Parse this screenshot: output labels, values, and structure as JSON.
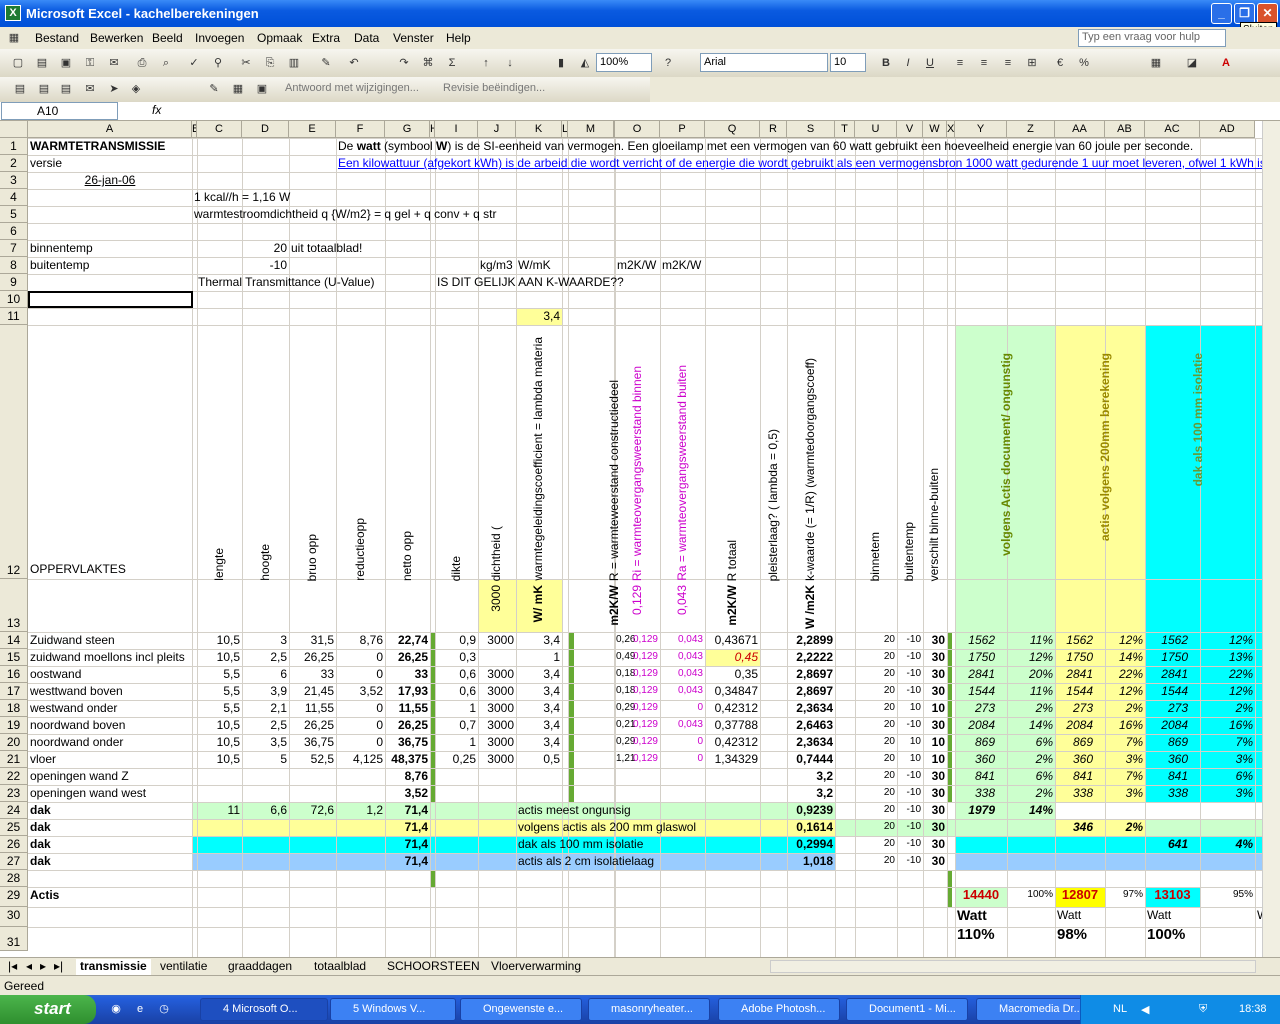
{
  "window": {
    "title": "Microsoft Excel - kachelberekeningen",
    "tooltip": "Sluiten"
  },
  "menu": [
    "Bestand",
    "Bewerken",
    "Beeld",
    "Invoegen",
    "Opmaak",
    "Extra",
    "Data",
    "Venster",
    "Help"
  ],
  "help_placeholder": "Typ een vraag voor hulp",
  "toolbar": {
    "zoom": "100%",
    "font": "Arial",
    "size": "10",
    "reply": "Antwoord met wijzigingen...",
    "revision": "Revisie beëindigen..."
  },
  "formula": {
    "namebox": "A10",
    "fx": "fx"
  },
  "columns": [
    "A",
    "B",
    "C",
    "D",
    "E",
    "F",
    "G",
    "H",
    "I",
    "J",
    "K",
    "L",
    "M",
    "N",
    "O",
    "P",
    "Q",
    "R",
    "S",
    "T",
    "U",
    "V",
    "W",
    "X",
    "Y",
    "Z",
    "AA",
    "AB",
    "AC",
    "AD"
  ],
  "rows": [
    "1",
    "2",
    "3",
    "4",
    "5",
    "6",
    "7",
    "8",
    "9",
    "10",
    "11",
    "12",
    "13",
    "14",
    "15",
    "16",
    "17",
    "18",
    "19",
    "20",
    "21",
    "22",
    "23",
    "24",
    "25",
    "26",
    "27",
    "28",
    "29",
    "30",
    "31"
  ],
  "top": {
    "a1": "WARMTETRANSMISSIE",
    "a2": "versie",
    "a3": "26-jan-06",
    "l1a": "De ",
    "l1b": "watt",
    "l1c": " (symbool ",
    "l1d": "W",
    "l1e": ") is de SI-eenheid van vermogen. Een gloeilamp met een vermogen van 60 watt gebruikt een hoeveelheid energie van 60 joule per seconde.",
    "l2": "Een kilowattuur (afgekort kWh) is de arbeid die wordt verricht of de energie die wordt gebruikt als een vermogensbron 1000 watt gedurende 1 uur moet leveren, ofwel 1 kWh is 3,6",
    "r4": "1 kcal//h = 1,16 W",
    "r5": "warmtestroomdichtheid q {W/m2} = q gel + q conv + q str",
    "a7": "binnentemp",
    "d7": "20",
    "e7": "uit totaalblad!",
    "a8": "buitentemp",
    "d8": "-10",
    "j8": "kg/m3",
    "k8": "W/mK",
    "o8": "m2K/W",
    "p8": "m2K/W",
    "b9": "Thermal Transmittance (U-Value)",
    "i9": "IS DIT GELIJK AAN K-WAARDE??",
    "k11": "3,4",
    "a12": "OPPERVLAKTES"
  },
  "vheaders": {
    "c": "lengte",
    "d": "hoogte",
    "e": "bruo opp",
    "f": "reductieopp",
    "g": "netto opp",
    "i": "dikte",
    "j": "dichtheid (",
    "k": "warmtegeleidingscoefficient = lambda materia",
    "m": "R = warmteweerstand constructiedeel",
    "o": "Ri = warmteovergangsweerstand binnen",
    "p": "Ra = warmteovergangsweerstand buiten",
    "q": "R totaal",
    "r": "pleisterlaag? ( lambda = 0,5)",
    "s": "k-waarde (= 1/R) (warmtedoorgangscoeff)",
    "u": "binnetem",
    "v": "buitentemp",
    "w": "verschilt binne-buiten",
    "y": "volgens Actis document/ ongunstig",
    "aa": "actis volgens 200mm berekening",
    "ac": "dak als 100 mm isolatie"
  },
  "r13": {
    "j": "3000",
    "k": "W/ mK",
    "m": "m2K/W",
    "o": "0,129",
    "p": "0,043",
    "q": "m2K/W",
    "s": "W /m2K"
  },
  "table": [
    [
      "Zuidwand steen",
      "10,5",
      "3",
      "31,5",
      "8,76",
      "22,74",
      "0,9",
      "3000",
      "3,4",
      "0,26",
      "0,129",
      "0,043",
      "0,43671",
      "2,2899",
      "20",
      "-10",
      "30",
      "1562",
      "11%",
      "1562",
      "12%",
      "1562",
      "12%"
    ],
    [
      "zuidwand moellons incl pleits",
      "10,5",
      "2,5",
      "26,25",
      "0",
      "26,25",
      "0,3",
      "",
      "1",
      "0,49",
      "0,129",
      "0,043",
      "0,45",
      "2,2222",
      "20",
      "-10",
      "30",
      "1750",
      "12%",
      "1750",
      "14%",
      "1750",
      "13%"
    ],
    [
      "oostwand",
      "5,5",
      "6",
      "33",
      "0",
      "33",
      "0,6",
      "3000",
      "3,4",
      "0,18",
      "0,129",
      "0,043",
      "0,35",
      "2,8697",
      "20",
      "-10",
      "30",
      "2841",
      "20%",
      "2841",
      "22%",
      "2841",
      "22%"
    ],
    [
      "westtwand boven",
      "5,5",
      "3,9",
      "21,45",
      "3,52",
      "17,93",
      "0,6",
      "3000",
      "3,4",
      "0,18",
      "0,129",
      "0,043",
      "0,34847",
      "2,8697",
      "20",
      "-10",
      "30",
      "1544",
      "11%",
      "1544",
      "12%",
      "1544",
      "12%"
    ],
    [
      "westwand onder",
      "5,5",
      "2,1",
      "11,55",
      "0",
      "11,55",
      "1",
      "3000",
      "3,4",
      "0,29",
      "0,129",
      "0",
      "0,42312",
      "2,3634",
      "20",
      "10",
      "10",
      "273",
      "2%",
      "273",
      "2%",
      "273",
      "2%"
    ],
    [
      "noordwand boven",
      "10,5",
      "2,5",
      "26,25",
      "0",
      "26,25",
      "0,7",
      "3000",
      "3,4",
      "0,21",
      "0,129",
      "0,043",
      "0,37788",
      "2,6463",
      "20",
      "-10",
      "30",
      "2084",
      "14%",
      "2084",
      "16%",
      "2084",
      "16%"
    ],
    [
      "noordwand onder",
      "10,5",
      "3,5",
      "36,75",
      "0",
      "36,75",
      "1",
      "3000",
      "3,4",
      "0,29",
      "0,129",
      "0",
      "0,42312",
      "2,3634",
      "20",
      "10",
      "10",
      "869",
      "6%",
      "869",
      "7%",
      "869",
      "7%"
    ],
    [
      "vloer",
      "10,5",
      "5",
      "52,5",
      "4,125",
      "48,375",
      "0,25",
      "3000",
      "0,5",
      "1,21",
      "0,129",
      "0",
      "1,34329",
      "0,7444",
      "20",
      "10",
      "10",
      "360",
      "2%",
      "360",
      "3%",
      "360",
      "3%"
    ],
    [
      "openingen wand Z",
      "",
      "",
      "",
      "",
      "8,76",
      "",
      "",
      "",
      "",
      "",
      "",
      "",
      "3,2",
      "20",
      "-10",
      "30",
      "841",
      "6%",
      "841",
      "7%",
      "841",
      "6%"
    ],
    [
      "openingen wand west",
      "",
      "",
      "",
      "",
      "3,52",
      "",
      "",
      "",
      "",
      "",
      "",
      "",
      "3,2",
      "20",
      "-10",
      "30",
      "338",
      "2%",
      "338",
      "3%",
      "338",
      "3%"
    ]
  ],
  "dak": [
    {
      "a": "dak",
      "c": "11",
      "d": "6,6",
      "e": "72,6",
      "f": "1,2",
      "g": "71,4",
      "label": "actis meest ongunsig",
      "s": "0,9239",
      "u": "20",
      "v": "-10",
      "w": "30",
      "val": "1979",
      "pct": "14%"
    },
    {
      "a": "dak",
      "g": "71,4",
      "label": "volgens actis als 200 mm glaswol",
      "s": "0,1614",
      "u": "20",
      "v": "-10",
      "w": "30",
      "val": "346",
      "pct": "2%"
    },
    {
      "a": "dak",
      "g": "71,4",
      "label": "dak als 100 mm isolatie",
      "s": "0,2994",
      "u": "20",
      "v": "-10",
      "w": "30",
      "val": "641",
      "pct": "4%"
    },
    {
      "a": "dak",
      "g": "71,4",
      "label": "actis als 2 cm isolatielaag",
      "s": "1,018",
      "u": "20",
      "v": "-10",
      "w": "30"
    }
  ],
  "totals": {
    "a29": "Actis",
    "y29": "14440",
    "z29": "100%",
    "aa29": "12807",
    "ab29": "97%",
    "ac29": "13103",
    "ad29": "95%",
    "y30": "Watt",
    "aa30": "Watt",
    "ac30": "Watt",
    "ad30": "W",
    "y31": "110%",
    "aa31": "98%",
    "ac31": "100%"
  },
  "tabs": [
    "transmissie",
    "ventilatie",
    "graaddagen",
    "totaalblad",
    "SCHOORSTEEN",
    "Vloerverwarming"
  ],
  "status": "Gereed",
  "taskbar": {
    "start": "start",
    "tasks": [
      "4 Microsoft O...",
      "5 Windows V...",
      "Ongewenste e...",
      "masonryheater...",
      "Adobe Photosh...",
      "Document1 - Mi...",
      "Macromedia Dr..."
    ],
    "lang": "NL",
    "clock": "18:38"
  },
  "colors": {
    "green": "#ccffcc",
    "yellow": "#ffff99",
    "cyan": "#00ffff",
    "pink": "#ff00ff",
    "blueband": "#99ccff"
  }
}
